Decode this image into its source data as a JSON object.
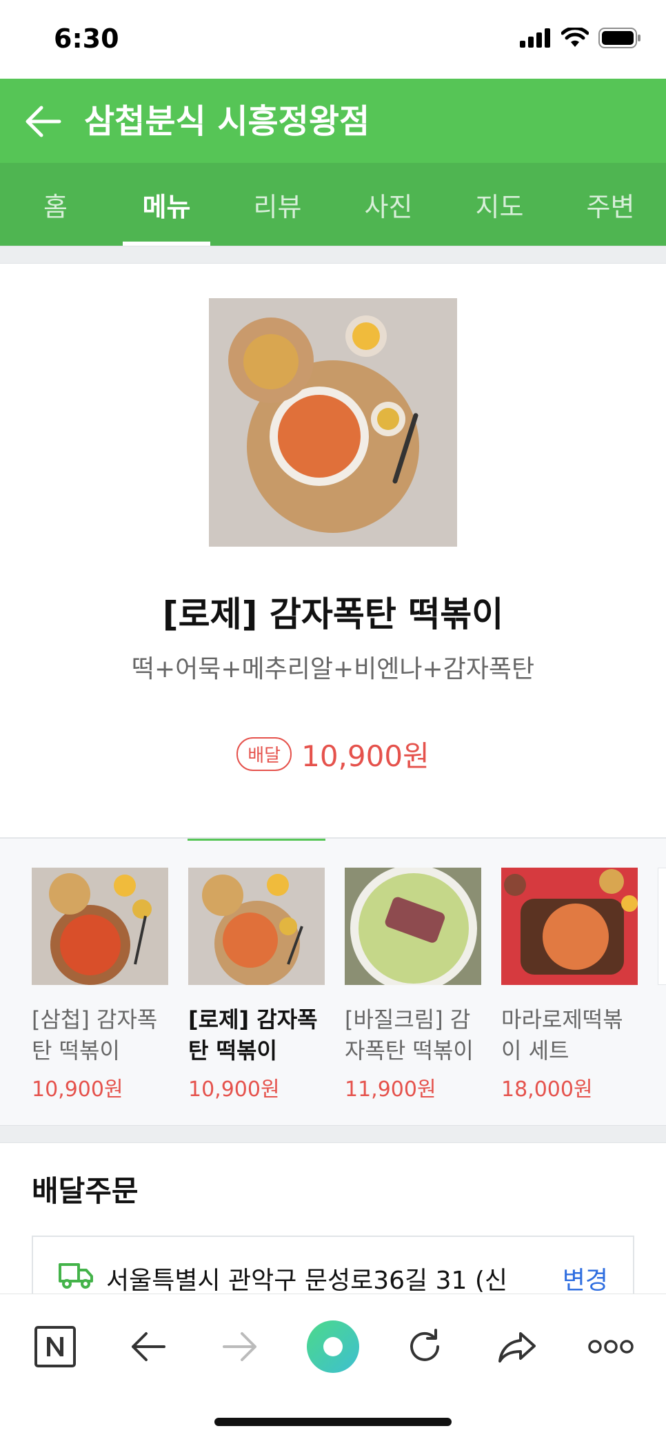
{
  "status_bar": {
    "time": "6:30"
  },
  "header": {
    "title": "삼첩분식 시흥정왕점"
  },
  "tabs": [
    {
      "label": "홈",
      "active": false
    },
    {
      "label": "메뉴",
      "active": true
    },
    {
      "label": "리뷰",
      "active": false
    },
    {
      "label": "사진",
      "active": false
    },
    {
      "label": "지도",
      "active": false
    },
    {
      "label": "주변",
      "active": false
    }
  ],
  "product": {
    "name": "[로제] 감자폭탄 떡볶이",
    "description": "떡+어묵+메추리알+비엔나+감자폭탄",
    "badge": "배달",
    "price": "10,900원"
  },
  "menu_items": [
    {
      "name": "[삼첩] 감자폭탄 떡볶이",
      "price": "10,900원",
      "active": false
    },
    {
      "name": "[로제] 감자폭탄 떡볶이",
      "price": "10,900원",
      "active": true
    },
    {
      "name": "[바질크림] 감자폭탄 떡볶이",
      "price": "11,900원",
      "active": false
    },
    {
      "name": "마라로제떡볶이 세트",
      "price": "18,000원",
      "active": false
    }
  ],
  "delivery": {
    "section_title": "배달주문",
    "address": "서울특별시 관악구 문성로36길 31 (신",
    "change_label": "변경"
  },
  "colors": {
    "brand_green": "#56c556",
    "tab_green": "#4fb551",
    "price_red": "#e5524c",
    "link_blue": "#2f6ee0"
  }
}
